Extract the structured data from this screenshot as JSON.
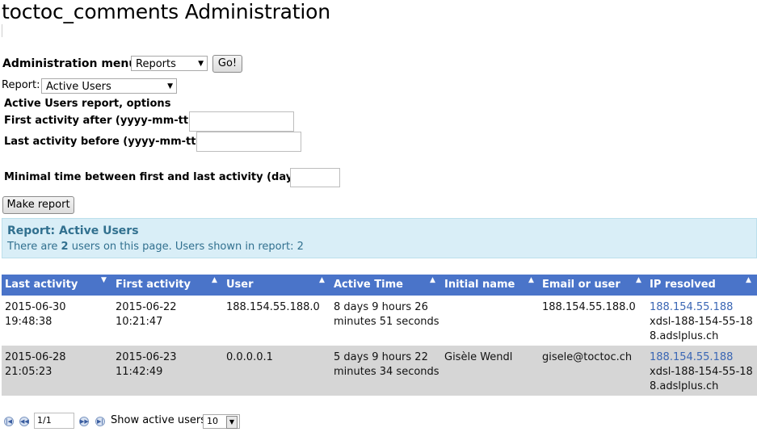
{
  "page_title": "toctoc_comments Administration",
  "admin_menu": {
    "label": "Administration menu",
    "selected": "Reports",
    "go_label": "Go!"
  },
  "report_select": {
    "label": "Report:",
    "selected": "Active Users"
  },
  "options": {
    "heading": "Active Users report, options",
    "first_activity_label": "First activity after (yyyy-mm-tt):",
    "first_activity_value": "",
    "last_activity_label": "Last activity before (yyyy-mm-tt):",
    "last_activity_value": "",
    "min_time_label": "Minimal time between first and last activity (days):",
    "min_time_value": "",
    "make_report_label": "Make report"
  },
  "info": {
    "heading": "Report: Active Users",
    "text_prefix": "There are ",
    "users_count": "2",
    "text_suffix": " users on this page. Users shown in report: 2"
  },
  "table": {
    "columns": [
      "Last activity",
      "First activity",
      "User",
      "Active Time",
      "Initial name",
      "Email or user",
      "IP resolved"
    ],
    "rows": [
      {
        "last_activity": [
          "2015-06-30",
          "19:48:38"
        ],
        "first_activity": [
          "2015-06-22",
          "10:21:47"
        ],
        "user": "188.154.55.188.0",
        "active_time": [
          "8 days 9 hours 26",
          "minutes 51 seconds"
        ],
        "initial_name": "",
        "email": "188.154.55.188.0",
        "ip": "188.154.55.188",
        "host": [
          "xdsl-188-154-55-18",
          "8.adslplus.ch"
        ]
      },
      {
        "last_activity": [
          "2015-06-28",
          "21:05:23"
        ],
        "first_activity": [
          "2015-06-23",
          "11:42:49"
        ],
        "user": "0.0.0.0.1",
        "active_time": [
          "5 days 9 hours 22",
          "minutes 34 seconds"
        ],
        "initial_name": "Gisèle Wendl",
        "email": "gisele@toctoc.ch",
        "ip": "188.154.55.188",
        "host": [
          "xdsl-188-154-55-18",
          "8.adslplus.ch"
        ]
      }
    ]
  },
  "pager": {
    "page_value": "1/1",
    "show_label": "Show active users",
    "per_page": "10",
    "icons": [
      "first-page-icon",
      "prev-page-icon",
      "next-page-icon",
      "last-page-icon"
    ]
  },
  "colors": {
    "header_bg": "#4a74c9",
    "info_bg": "#d9eef7",
    "info_text": "#31708f",
    "link": "#3a66b4",
    "alt_row": "#d6d6d6"
  }
}
